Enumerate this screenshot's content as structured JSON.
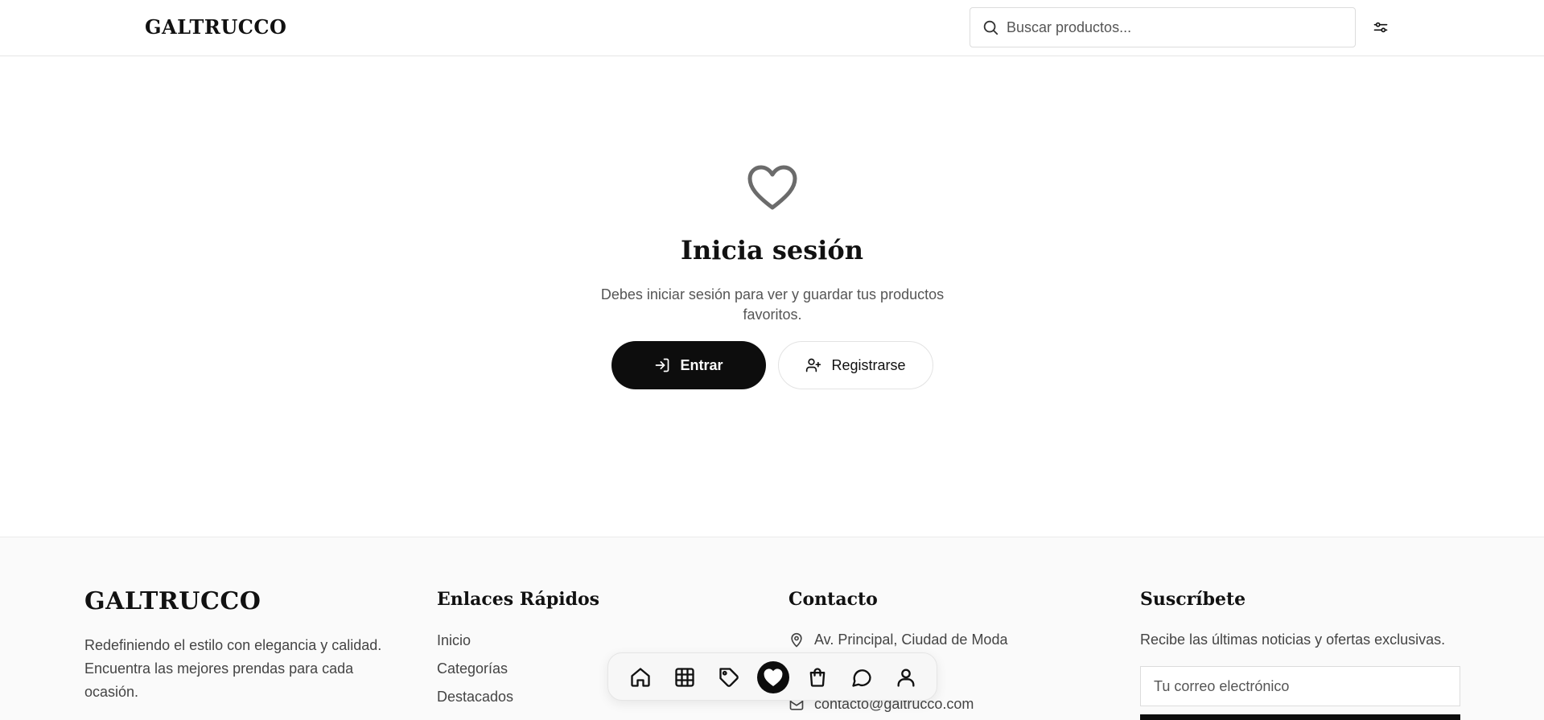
{
  "header": {
    "logo": "GALTRUCCO",
    "search_placeholder": "Buscar productos...",
    "icons": {
      "search": "search-icon",
      "filter": "sliders-icon"
    }
  },
  "main": {
    "icon": "heart-icon",
    "title": "Inicia sesión",
    "subtitle": "Debes iniciar sesión para ver y guardar tus productos favoritos.",
    "login_label": "Entrar",
    "register_label": "Registrarse"
  },
  "footer": {
    "logo": "GALTRUCCO",
    "description": "Redefiniendo el estilo con elegancia y calidad. Encuentra las mejores prendas para cada ocasión.",
    "quick_links": {
      "heading": "Enlaces Rápidos",
      "items": [
        "Inicio",
        "Categorías",
        "Destacados"
      ]
    },
    "contact": {
      "heading": "Contacto",
      "address": "Av. Principal, Ciudad de Moda",
      "email": "contacto@galtrucco.com"
    },
    "newsletter": {
      "heading": "Suscríbete",
      "text": "Recibe las últimas noticias y ofertas exclusivas.",
      "email_placeholder": "Tu correo electrónico"
    }
  },
  "bottom_nav": {
    "items": [
      "home-icon",
      "grid-icon",
      "tag-icon",
      "heart-icon",
      "shopping-bag-icon",
      "chat-icon",
      "user-icon"
    ],
    "active": "heart-icon"
  },
  "colors": {
    "primary": "#0d0d0d",
    "text": "#111111",
    "muted": "#555555",
    "footer_bg": "#fafafa",
    "heart_icon": "#6b6b6b"
  }
}
